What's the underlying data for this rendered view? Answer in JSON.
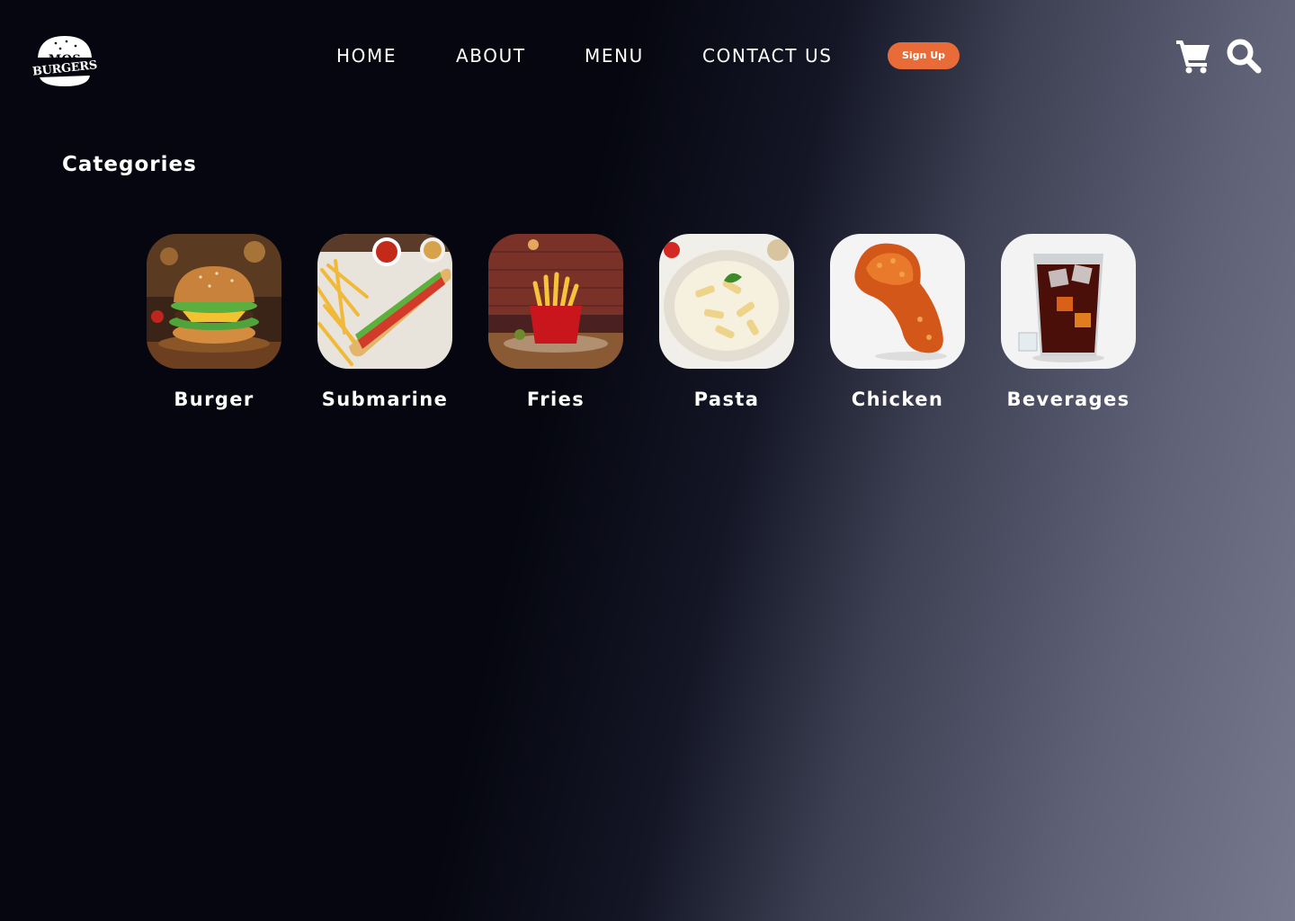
{
  "brand": {
    "logo_line1": "MOS",
    "logo_line2": "BURGERS"
  },
  "nav": {
    "items": [
      {
        "label": "HOME"
      },
      {
        "label": "ABOUT"
      },
      {
        "label": "MENU"
      },
      {
        "label": "CONTACT US"
      }
    ],
    "signup_label": "Sign Up"
  },
  "header_icons": [
    "cart-icon",
    "search-icon"
  ],
  "categories": {
    "title": "Categories",
    "items": [
      {
        "label": "Burger",
        "image": "burger-image"
      },
      {
        "label": "Submarine",
        "image": "submarine-image"
      },
      {
        "label": "Fries",
        "image": "fries-image"
      },
      {
        "label": "Pasta",
        "image": "pasta-image"
      },
      {
        "label": "Chicken",
        "image": "chicken-image"
      },
      {
        "label": "Beverages",
        "image": "beverages-image"
      }
    ]
  },
  "colors": {
    "background_dark": "#05060f",
    "background_light": "#777a8f",
    "accent": "#e96c38",
    "text": "#ffffff"
  }
}
